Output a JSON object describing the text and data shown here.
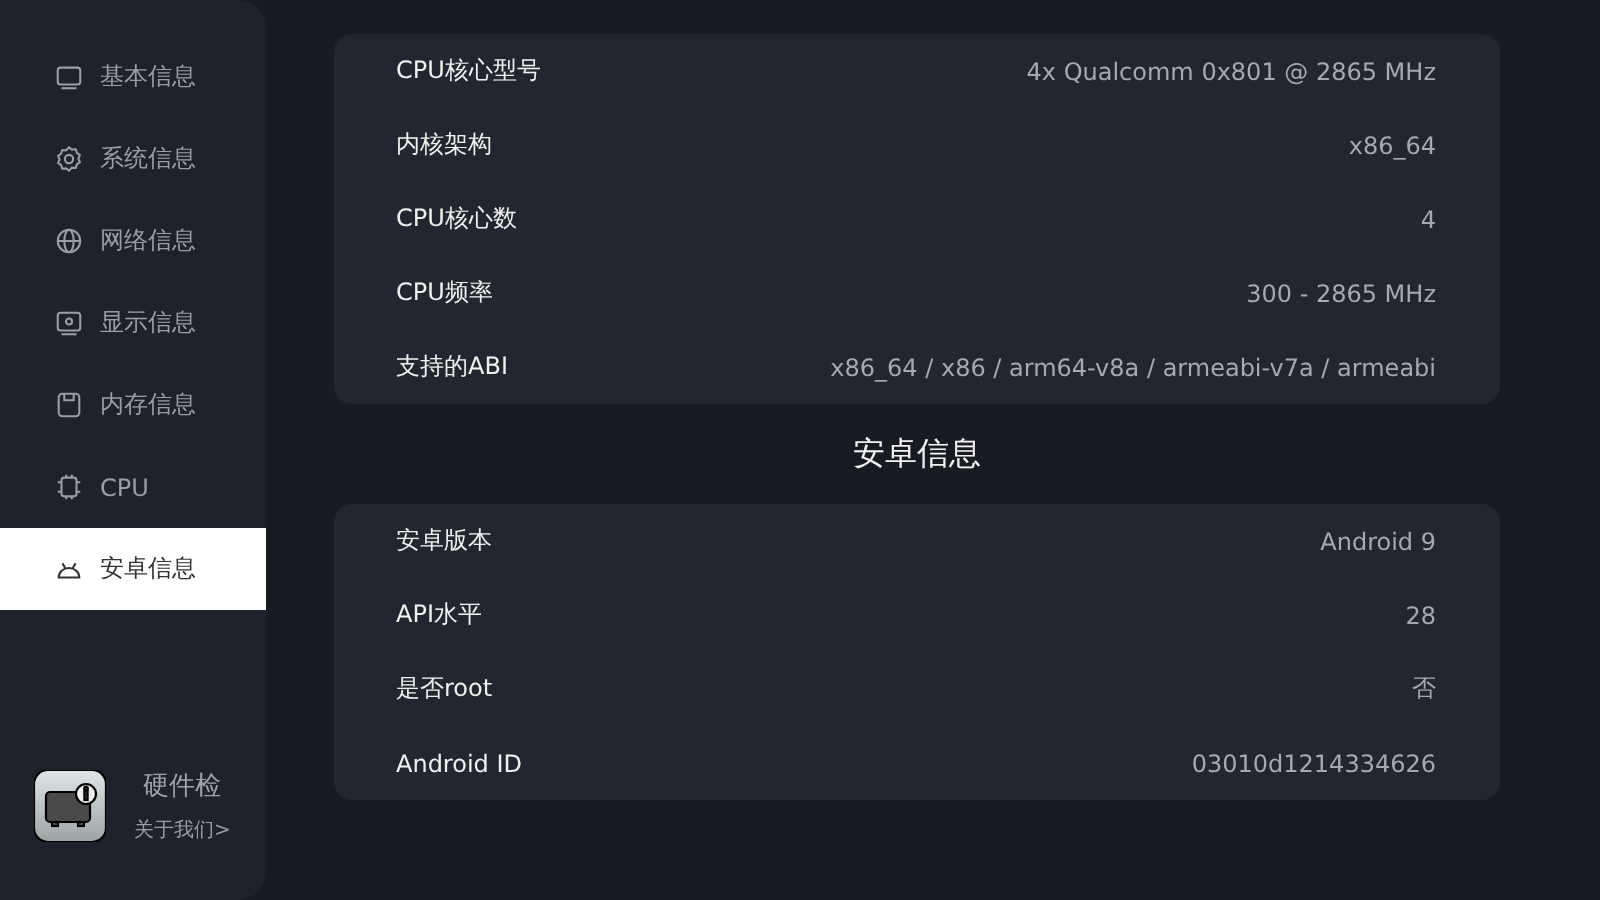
{
  "sidebar": {
    "items": [
      {
        "label": "基本信息",
        "selected": false
      },
      {
        "label": "系统信息",
        "selected": false
      },
      {
        "label": "网络信息",
        "selected": false
      },
      {
        "label": "显示信息",
        "selected": false
      },
      {
        "label": "内存信息",
        "selected": false
      },
      {
        "label": "CPU",
        "selected": false
      },
      {
        "label": "安卓信息",
        "selected": true
      }
    ],
    "app": {
      "name": "硬件检",
      "link": "关于我们>"
    }
  },
  "sections": [
    {
      "rows": [
        {
          "label": "CPU核心型号",
          "value": "4x Qualcomm 0x801 @ 2865 MHz"
        },
        {
          "label": "内核架构",
          "value": "x86_64"
        },
        {
          "label": "CPU核心数",
          "value": "4"
        },
        {
          "label": "CPU频率",
          "value": "300 - 2865 MHz"
        },
        {
          "label": "支持的ABI",
          "value": "x86_64 / x86 / arm64-v8a / armeabi-v7a / armeabi"
        }
      ]
    },
    {
      "title": "安卓信息",
      "rows": [
        {
          "label": "安卓版本",
          "value": "Android 9"
        },
        {
          "label": "API水平",
          "value": "28"
        },
        {
          "label": "是否root",
          "value": "否"
        },
        {
          "label": "Android ID",
          "value": "03010d1214334626"
        }
      ]
    }
  ]
}
